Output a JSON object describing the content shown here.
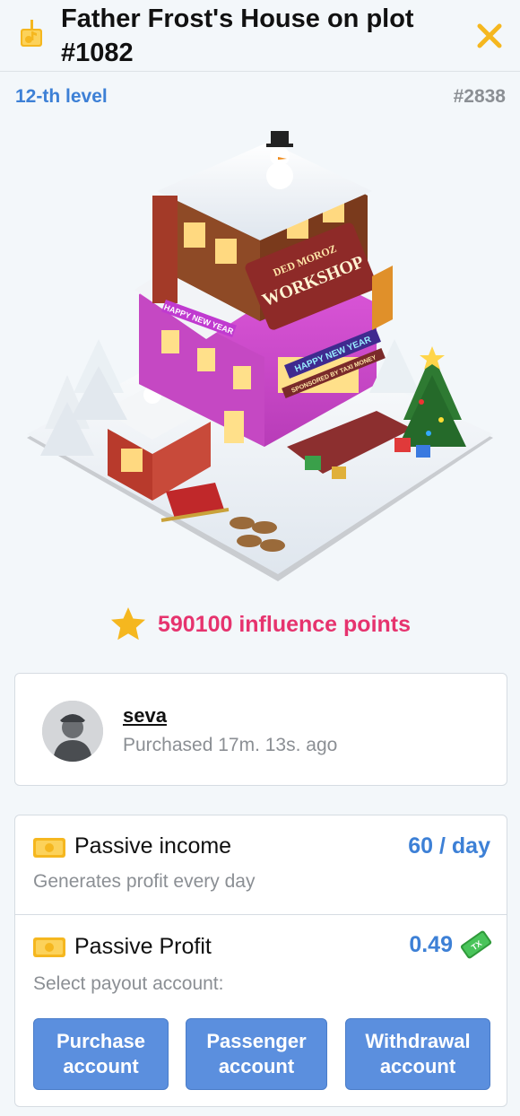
{
  "header": {
    "title": "Father Frost's House on plot #1082",
    "title_icon": "music-note-sign-icon",
    "close_icon": "close-icon"
  },
  "meta": {
    "level": "12-th level",
    "number": "#2838"
  },
  "building": {
    "sign_top": "DED MOROZ",
    "sign_main": "WORKSHOP",
    "banner_left": "HAPPY NEW YEAR",
    "banner_right": "HAPPY NEW YEAR",
    "banner_sub": "SPONSORED BY TAXI MONEY"
  },
  "influence": {
    "icon": "star-icon",
    "text": "590100 influence points"
  },
  "owner": {
    "name": "seva",
    "purchased": "Purchased 17m. 13s. ago"
  },
  "income": {
    "passive_income": {
      "icon": "money-icon",
      "title": "Passive income",
      "value": "60 / day",
      "subtitle": "Generates profit every day"
    },
    "passive_profit": {
      "icon": "money-icon",
      "title": "Passive Profit",
      "value": "0.49",
      "value_icon": "tx-banknote-icon",
      "subtitle": "Select payout account:"
    },
    "buttons": {
      "purchase": "Purchase account",
      "passenger": "Passenger account",
      "withdrawal": "Withdrawal account"
    }
  },
  "colors": {
    "accent_blue": "#3d80d6",
    "button_blue": "#5b8fde",
    "points_pink": "#e6336e",
    "icon_gold": "#f5b71f"
  }
}
